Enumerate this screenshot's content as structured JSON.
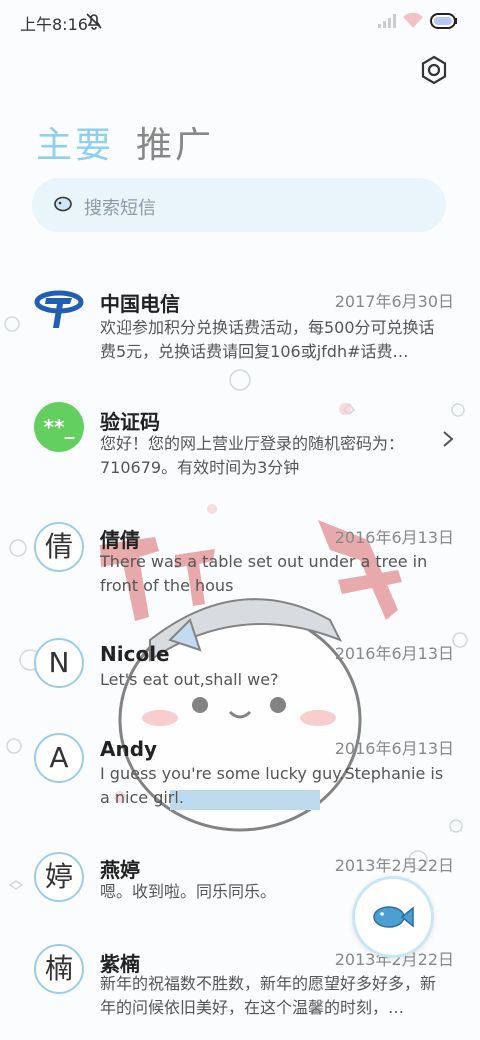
{
  "status_bar": {
    "time": "上午8:16",
    "battery": "100"
  },
  "tabs": {
    "primary": "主要",
    "promotions": "推广"
  },
  "search": {
    "placeholder": "搜索短信"
  },
  "messages": [
    {
      "sender": "中国电信",
      "date": "2017年6月30日",
      "preview": "欢迎参加积分兑换话费活动，每500分可兑换话费5元，兑换话费请回复106或jfdh#话费…"
    },
    {
      "sender": "验证码",
      "avatar_text": "**_",
      "preview": "您好！您的网上营业厅登录的随机密码为：710679。有效时间为3分钟"
    },
    {
      "sender": "倩倩",
      "avatar_text": "倩",
      "date": "2016年6月13日",
      "preview": "There was a table set out under a tree in front of the hous"
    },
    {
      "sender": "Nicole",
      "avatar_text": "N",
      "date": "2016年6月13日",
      "preview": "Let's eat out,shall we?"
    },
    {
      "sender": "Andy",
      "avatar_text": "A",
      "date": "2016年6月13日",
      "preview": "I guess you're some lucky guy.Stephanie is a nice girl."
    },
    {
      "sender": "燕婷",
      "avatar_text": "婷",
      "date": "2013年2月22日",
      "preview": "嗯。收到啦。同乐同乐。"
    },
    {
      "sender": "紫楠",
      "avatar_text": "楠",
      "date": "2013年2月22日",
      "preview": "新年的祝福数不胜数，新年的愿望好多好多，新年的问候依旧美好，在这个温馨的时刻，…"
    }
  ],
  "colors": {
    "accent": "#8fd0ee",
    "verify_green": "#63cf5e",
    "telecom_blue": "#1f5fb4"
  },
  "icons": [
    "bell-mute-icon",
    "signal-icon",
    "wifi-icon",
    "battery-icon",
    "gear-icon",
    "search-icon",
    "china-telecom-logo",
    "chevron-right-icon",
    "fish-icon"
  ]
}
